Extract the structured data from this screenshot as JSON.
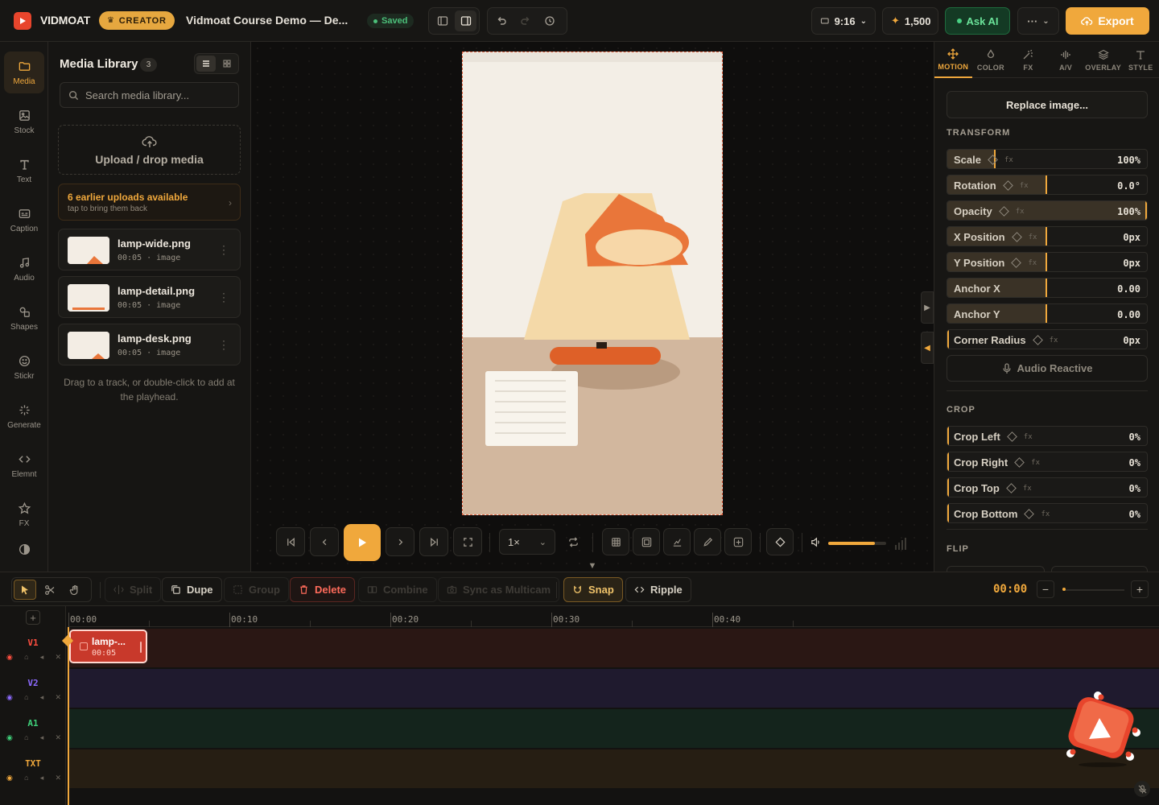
{
  "app": {
    "brand": "VIDMOAT",
    "plan_badge": "CREATOR",
    "project_title": "Vidmoat Course Demo — De...",
    "save_status": "Saved",
    "aspect": "9:16",
    "credits": "1,500",
    "ask_ai": "Ask AI",
    "more": "···",
    "export": "Export",
    "accent_color": "#f0a83c",
    "brand_color": "#e8452c"
  },
  "rail": [
    {
      "label": "Media",
      "icon": "folder-icon",
      "active": true
    },
    {
      "label": "Stock",
      "icon": "image-icon"
    },
    {
      "label": "Text",
      "icon": "text-icon"
    },
    {
      "label": "Caption",
      "icon": "caption-icon"
    },
    {
      "label": "Audio",
      "icon": "music-icon"
    },
    {
      "label": "Shapes",
      "icon": "shapes-icon"
    },
    {
      "label": "Stickr",
      "icon": "smile-icon"
    },
    {
      "label": "Generate",
      "icon": "sparkle-icon"
    },
    {
      "label": "Elemnt",
      "icon": "code-icon"
    },
    {
      "label": "FX",
      "icon": "star-icon"
    }
  ],
  "media": {
    "title": "Media Library",
    "count": "3",
    "search_placeholder": "Search media library...",
    "upload_label": "Upload / drop media",
    "earlier_title": "6 earlier uploads available",
    "earlier_sub": "tap to bring them back",
    "items": [
      {
        "name": "lamp-wide.png",
        "meta": "00:05 · image"
      },
      {
        "name": "lamp-detail.png",
        "meta": "00:05 · image"
      },
      {
        "name": "lamp-desk.png",
        "meta": "00:05 · image"
      }
    ],
    "hint": "Drag to a track, or double-click to add at the playhead."
  },
  "player": {
    "speed": "1×",
    "volume_fraction": 0.8
  },
  "inspector": {
    "tabs": [
      {
        "label": "MOTION",
        "icon": "move-icon",
        "active": true
      },
      {
        "label": "COLOR",
        "icon": "drop-icon"
      },
      {
        "label": "FX",
        "icon": "wand-icon"
      },
      {
        "label": "A/V",
        "icon": "waveform-icon"
      },
      {
        "label": "OVERLAY",
        "icon": "layers-icon"
      },
      {
        "label": "STYLE",
        "icon": "type-icon"
      }
    ],
    "replace_label": "Replace image...",
    "transform_heading": "TRANSFORM",
    "transform": [
      {
        "label": "Scale",
        "value": "100%",
        "fill": 0.24,
        "kf": true
      },
      {
        "label": "Rotation",
        "value": "0.0°",
        "fill": 0.5,
        "kf": true
      },
      {
        "label": "Opacity",
        "value": "100%",
        "fill": 1.0,
        "kf": true
      },
      {
        "label": "X Position",
        "value": "0px",
        "fill": 0.5,
        "kf": true
      },
      {
        "label": "Y Position",
        "value": "0px",
        "fill": 0.5,
        "kf": true
      },
      {
        "label": "Anchor X",
        "value": "0.00",
        "fill": 0.5,
        "kf": false
      },
      {
        "label": "Anchor Y",
        "value": "0.00",
        "fill": 0.5,
        "kf": false
      },
      {
        "label": "Corner Radius",
        "value": "0px",
        "fill": 0.0,
        "kf": true
      }
    ],
    "audio_reactive": "Audio Reactive",
    "crop_heading": "CROP",
    "crop": [
      {
        "label": "Crop Left",
        "value": "0%"
      },
      {
        "label": "Crop Right",
        "value": "0%"
      },
      {
        "label": "Crop Top",
        "value": "0%"
      },
      {
        "label": "Crop Bottom",
        "value": "0%"
      }
    ],
    "flip_heading": "FLIP",
    "fx_tag": "fx"
  },
  "timeline": {
    "split": "Split",
    "dupe": "Dupe",
    "group": "Group",
    "delete": "Delete",
    "combine": "Combine",
    "sync": "Sync as Multicam",
    "snap": "Snap",
    "ripple": "Ripple",
    "time": "00:00",
    "ruler": [
      "00:00",
      "00:10",
      "00:20",
      "00:30",
      "00:40"
    ],
    "tracks": [
      {
        "name": "V1",
        "color": "#ff4f40",
        "lane": "#2a1714"
      },
      {
        "name": "V2",
        "color": "#8d6bff",
        "lane": "#1f1a2e"
      },
      {
        "name": "A1",
        "color": "#3fd07a",
        "lane": "#14241c"
      },
      {
        "name": "TXT",
        "color": "#f0a83c",
        "lane": "#261e13"
      }
    ],
    "clip": {
      "name": "lamp-...",
      "duration": "00:05"
    }
  }
}
